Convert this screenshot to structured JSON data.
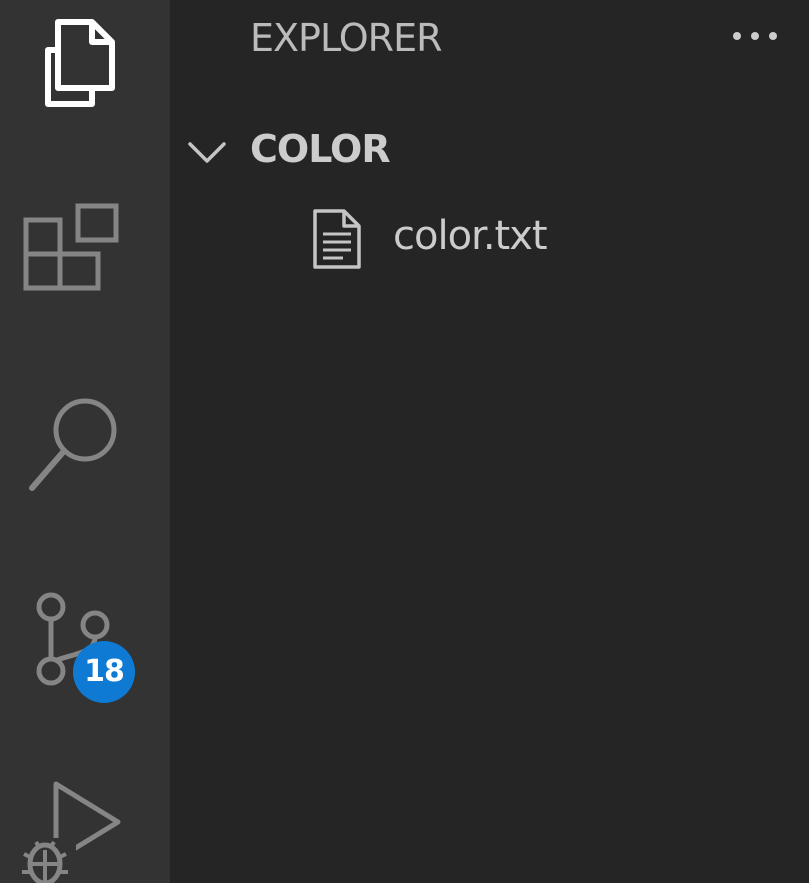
{
  "activity_bar": {
    "items": [
      {
        "name": "explorer",
        "icon": "files-icon",
        "active": true
      },
      {
        "name": "extensions",
        "icon": "extensions-icon",
        "active": false
      },
      {
        "name": "search",
        "icon": "search-icon",
        "active": false
      },
      {
        "name": "source-control",
        "icon": "source-control-icon",
        "active": false,
        "badge": "18"
      },
      {
        "name": "run-and-debug",
        "icon": "run-debug-icon",
        "active": false
      }
    ],
    "source_control_badge": "18"
  },
  "sidebar": {
    "title": "EXPLORER",
    "more_actions_icon": "ellipsis-icon",
    "folder": {
      "label": "COLOR",
      "expanded": true,
      "files": [
        {
          "label": "color.txt",
          "icon": "text-file-icon"
        }
      ]
    }
  },
  "colors": {
    "activity_bar_bg": "#333333",
    "sidebar_bg": "#252526",
    "active_icon": "#ffffff",
    "inactive_icon": "#858585",
    "badge_bg": "#0e7ad4",
    "text": "#cccccc"
  }
}
